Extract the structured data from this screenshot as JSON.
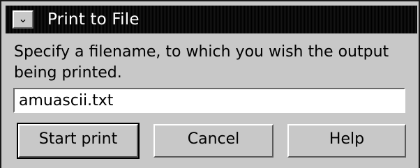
{
  "window": {
    "title": "Print to File",
    "system_menu_glyph": "⌄"
  },
  "message": "Specify a filename, to which you wish the output being printed.",
  "filename_input": {
    "value": "amuascii.txt"
  },
  "buttons": {
    "start_label": "Start print",
    "cancel_label": "Cancel",
    "help_label": "Help"
  },
  "colors": {
    "dialog_bg": "#c8c8c8",
    "titlebar_bg": "#000000",
    "title_text": "#ffffff"
  }
}
